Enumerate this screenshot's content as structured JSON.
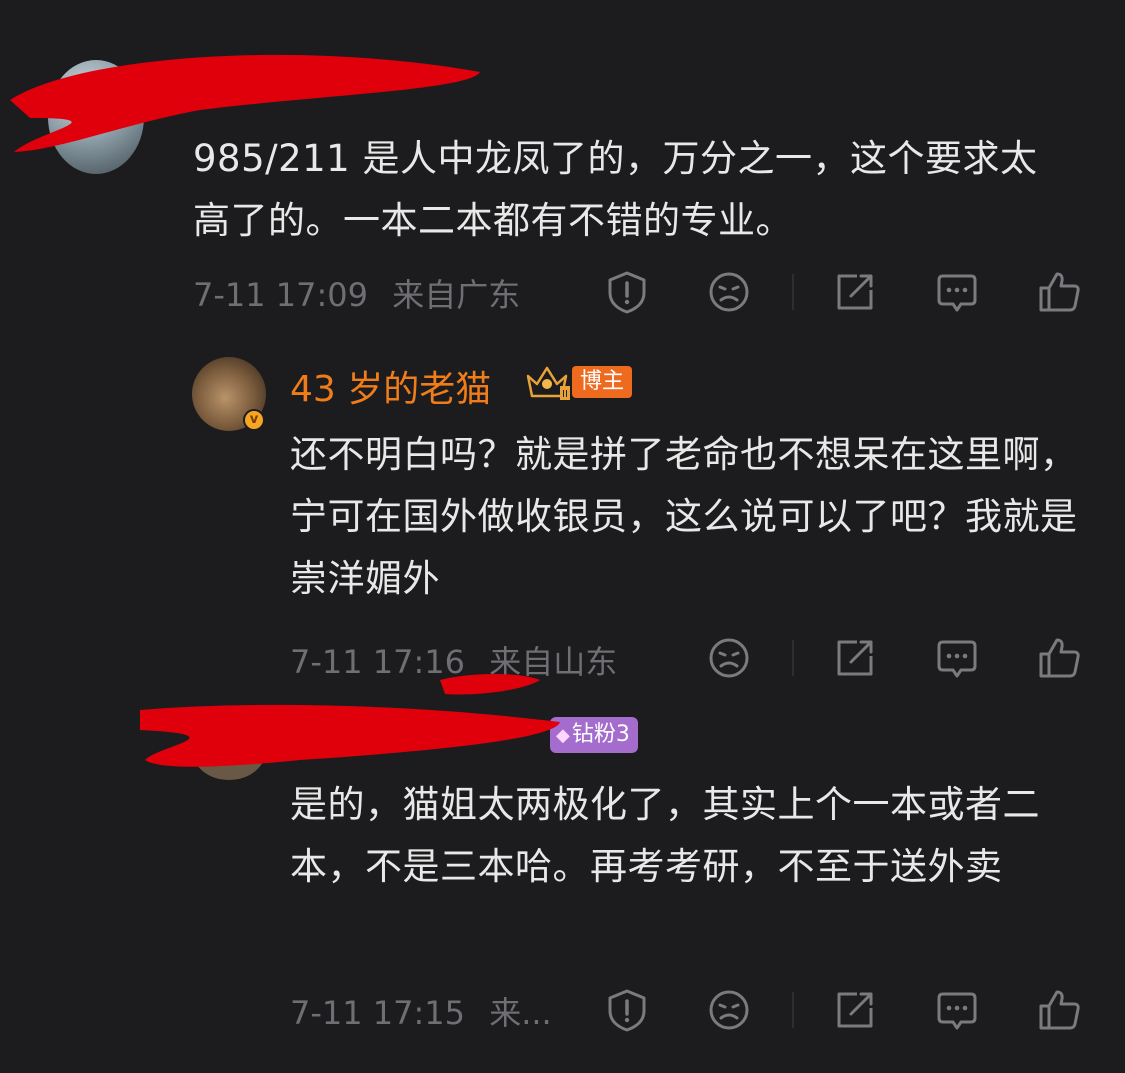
{
  "comments": [
    {
      "username": "",
      "text": "985/211 是人中龙凤了的，万分之一，这个要求太高了的。一本二本都有不错的专业。",
      "time": "7-11 17:09",
      "location": "来自广东",
      "icons": [
        "report-icon",
        "dislike-face-icon",
        "share-icon",
        "reply-icon",
        "like-icon"
      ]
    },
    {
      "username": "43 岁的老猫",
      "badge": "博主",
      "verified_mark": "v",
      "text": "还不明白吗？就是拼了老命也不想呆在这里啊，宁可在国外做收银员，这么说可以了吧？我就是崇洋媚外",
      "time": "7-11 17:16",
      "location": "来自山东",
      "icons": [
        "dislike-face-icon",
        "share-icon",
        "reply-icon",
        "like-icon"
      ]
    },
    {
      "username": "",
      "badge": "钻粉3",
      "text": "是的，猫姐太两极化了，其实上个一本或者二本，不是三本哈。再考考研，不至于送外卖",
      "time": "7-11 17:15",
      "location": "来...",
      "icons": [
        "report-icon",
        "dislike-face-icon",
        "share-icon",
        "reply-icon",
        "like-icon"
      ]
    }
  ],
  "colors": {
    "background": "#1c1c1e",
    "text": "#e8e8e8",
    "meta": "#6e6e73",
    "username_accent": "#f07d1a",
    "blogger_badge": "#ee6a1f",
    "fan_badge": "#a46ccc",
    "redaction": "#e0000b"
  }
}
